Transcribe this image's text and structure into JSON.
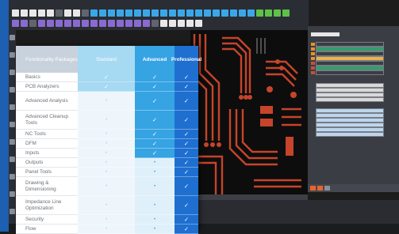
{
  "table": {
    "header_label": "Functionality Packages",
    "columns": [
      "Standard",
      "Advanced",
      "Professional"
    ],
    "check_symbol": "✓",
    "dash_symbol": "•",
    "rows": [
      {
        "label": "Basics",
        "std": true,
        "adv": true,
        "pro": true
      },
      {
        "label": "PCB Analyzers",
        "std": true,
        "adv": true,
        "pro": true
      },
      {
        "label": "Advanced Analysis",
        "std": false,
        "adv": true,
        "pro": true
      },
      {
        "label": "Advanced Cleanup Tools",
        "std": false,
        "adv": true,
        "pro": true
      },
      {
        "label": "NC Tools",
        "std": false,
        "adv": true,
        "pro": true
      },
      {
        "label": "DFM",
        "std": false,
        "adv": true,
        "pro": true
      },
      {
        "label": "Inputs",
        "std": false,
        "adv": true,
        "pro": true
      },
      {
        "label": "Outputs",
        "std": false,
        "adv": false,
        "pro": true
      },
      {
        "label": "Panel Tools",
        "std": false,
        "adv": false,
        "pro": true
      },
      {
        "label": "Drawing & Dimensioning",
        "std": false,
        "adv": false,
        "pro": true
      },
      {
        "label": "Impedance Line Optimization",
        "std": false,
        "adv": false,
        "pro": true
      },
      {
        "label": "Security",
        "std": false,
        "adv": false,
        "pro": true
      },
      {
        "label": "Flow",
        "std": false,
        "adv": false,
        "pro": true
      }
    ]
  },
  "colors": {
    "standard": "#a6d9f2",
    "advanced": "#36a3e3",
    "professional": "#1e6fd0",
    "pcb_trace": "#c6442a",
    "layer_highlight": "#e8902c"
  }
}
